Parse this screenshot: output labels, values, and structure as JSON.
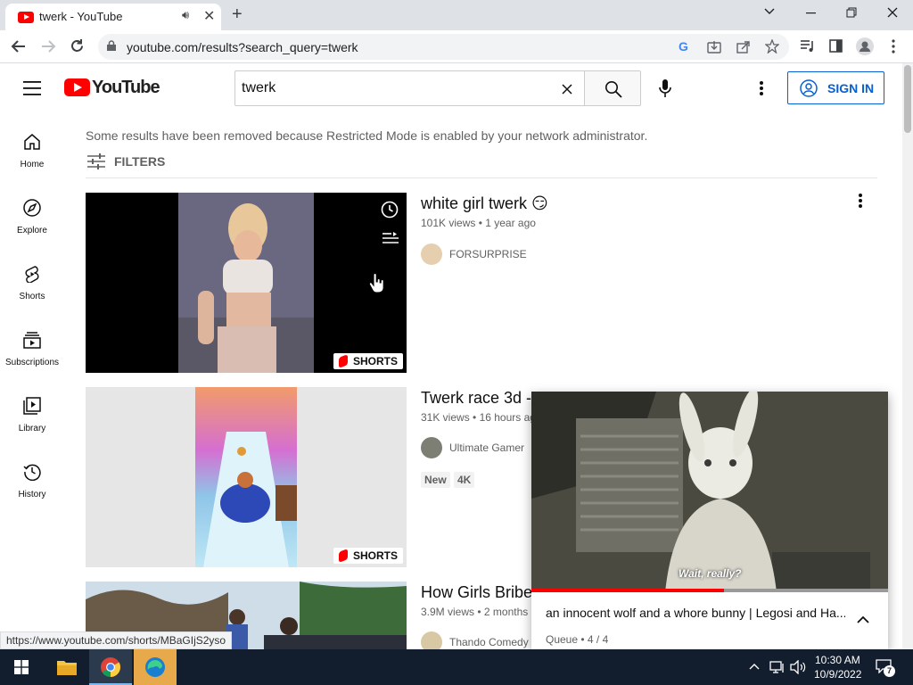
{
  "browser": {
    "tab_title": "twerk - YouTube",
    "new_tab": "+",
    "url": "youtube.com/results?search_query=twerk",
    "status_url": "https://www.youtube.com/shorts/MBaGIjS2yso"
  },
  "header": {
    "logo_text": "YouTube",
    "search_value": "twerk",
    "sign_in_label": "SIGN IN"
  },
  "guide": {
    "items": [
      {
        "label": "Home",
        "icon": "home-icon"
      },
      {
        "label": "Explore",
        "icon": "explore-icon"
      },
      {
        "label": "Shorts",
        "icon": "shorts-icon"
      },
      {
        "label": "Subscriptions",
        "icon": "subscriptions-icon"
      },
      {
        "label": "Library",
        "icon": "library-icon"
      },
      {
        "label": "History",
        "icon": "history-icon"
      }
    ]
  },
  "results": {
    "restricted_notice": "Some results have been removed because Restricted Mode is enabled by your network administrator.",
    "filters_label": "FILTERS",
    "videos": [
      {
        "title": "white girl twerk 😏",
        "views": "101K views",
        "age": "1 year ago",
        "channel": "FORSURPRISE",
        "badge": "SHORTS"
      },
      {
        "title": "Twerk race 3d -",
        "views": "31K views",
        "age": "16 hours ag",
        "channel": "Ultimate Gamer",
        "badge": "SHORTS",
        "tags": [
          "New",
          "4K"
        ]
      },
      {
        "title": "How Girls Bribe",
        "views": "3.9M views",
        "age": "2 months",
        "channel": "Thando Comedy"
      }
    ]
  },
  "miniplayer": {
    "subtitle": "Wait, really?",
    "title": "an innocent wolf and a whore bunny | Legosi and Ha...",
    "queue_label": "Queue",
    "queue_pos": "4 / 4",
    "progress": 0.54
  },
  "taskbar": {
    "time": "10:30 AM",
    "date": "10/9/2022",
    "notifications": "7"
  },
  "colors": {
    "yt_red": "#ff0000",
    "link_blue": "#065fd4",
    "taskbar": "#121e2e"
  }
}
